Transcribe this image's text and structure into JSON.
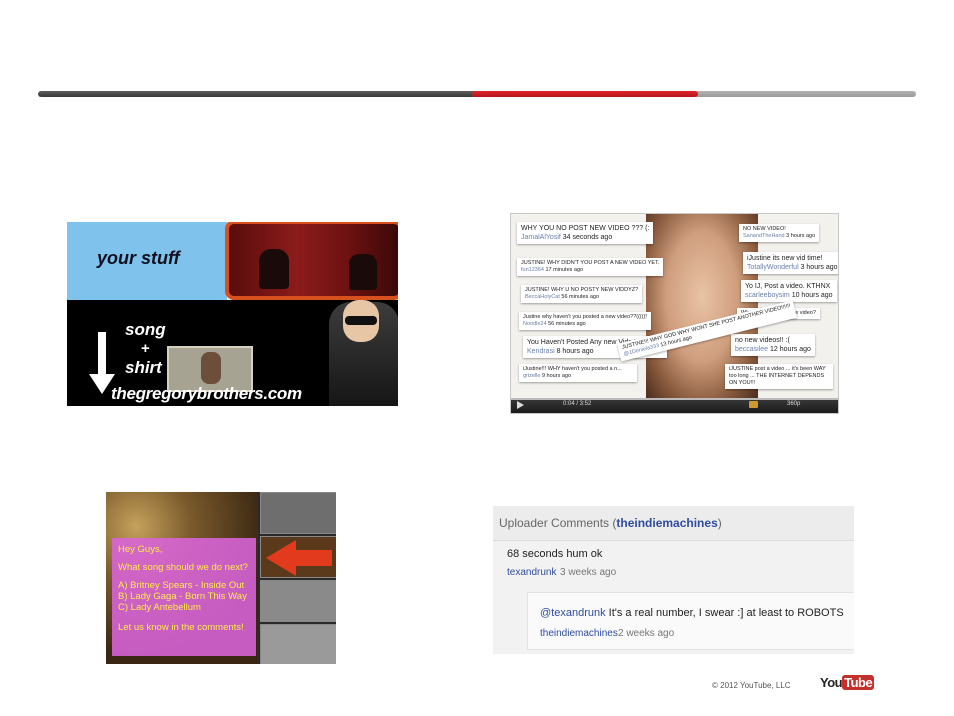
{
  "panel1": {
    "your_stuff": "your stuff",
    "song": "song",
    "plus": "+",
    "shirt": "shirt",
    "url": "thegregorybrothers.com"
  },
  "panel2": {
    "comments": [
      {
        "text": "WHY YOU NO POST NEW VIDEO ??? (:",
        "user": "JamalAlYosif",
        "time": "34 seconds ago"
      },
      {
        "text": "JUSTINE! WHY DIDN'T YOU POST A NEW VIDEO YET.",
        "user": "fun12364",
        "time": "17 minutes ago"
      },
      {
        "text": "JUSTINE! WHY U NO POSTY NEW VIDDYZ?",
        "user": "BeccaHolyCat",
        "time": "56 minutes ago"
      },
      {
        "text": "Justine why haven't you posted a new video??(((((!",
        "user": "Noodle24",
        "time": "56 minutes ago"
      },
      {
        "text": "You Haven't Posted Any new Vids In AGES!",
        "user": "Kendrasi",
        "time": "8 hours ago"
      },
      {
        "text": "iJustine!!! WHY haven't you posted a n...",
        "user": "grizelle",
        "time": "9 hours ago"
      },
      {
        "text": "NO NEW VIDEO!",
        "user": "SanandTheHand",
        "time": "3 hours ago"
      },
      {
        "text": "iJustine its new vid time!",
        "user": "TotallyWonderful",
        "time": "3 hours ago"
      },
      {
        "text": "Yo IJ, Post a video. KTHNX",
        "user": "scarleeboysim",
        "time": "10 hours ago"
      },
      {
        "text": "Why you no post a new video?",
        "user": "",
        "time": ""
      },
      {
        "text": "no new videos!! :(",
        "user": "beccasilee",
        "time": "12 hours ago"
      },
      {
        "text": "JUSTINE!!! WHY GOD WHY WONT SHE POST ANOTHER VIDEO!!!!!!",
        "user": "@1Deniela333",
        "time": "13 hours ago"
      },
      {
        "text": "iJUSTINE post a video ... it's been WAY too long ... THE INTERNET DEPENDS ON YOU!!!",
        "user": "",
        "time": ""
      }
    ],
    "time": "0:04 / 3:52",
    "quality": "360p"
  },
  "panel3": {
    "lines": [
      "Hey Guys,",
      "What song should we do next?",
      "A) Britney Spears - Inside Out",
      "B) Lady Gaga - Born This Way",
      "C) Lady Antebellum",
      "Let us know in the comments!"
    ]
  },
  "panel4": {
    "header_prefix": "Uploader Comments (",
    "header_user": "theindiemachines",
    "header_suffix": ")",
    "comment1": {
      "text": "68 seconds hum ok",
      "user": "texandrunk",
      "time": "3 weeks ago"
    },
    "reply": {
      "mention": "@texandrunk",
      "text": " It's a real number, I swear :] at least to ROBOTS",
      "user": "theindiemachines",
      "time": "2 weeks ago"
    }
  },
  "footer": {
    "copyright": "© 2012 YouTube, LLC",
    "logo_you": "You",
    "logo_tube": "Tube"
  },
  "colors": {
    "accent_red": "#d21f25",
    "bar_dark": "#4a4a4a",
    "bar_grey": "#a8a8a8",
    "link_blue": "#2f4c9e",
    "highlight_orange": "#d8501e"
  }
}
